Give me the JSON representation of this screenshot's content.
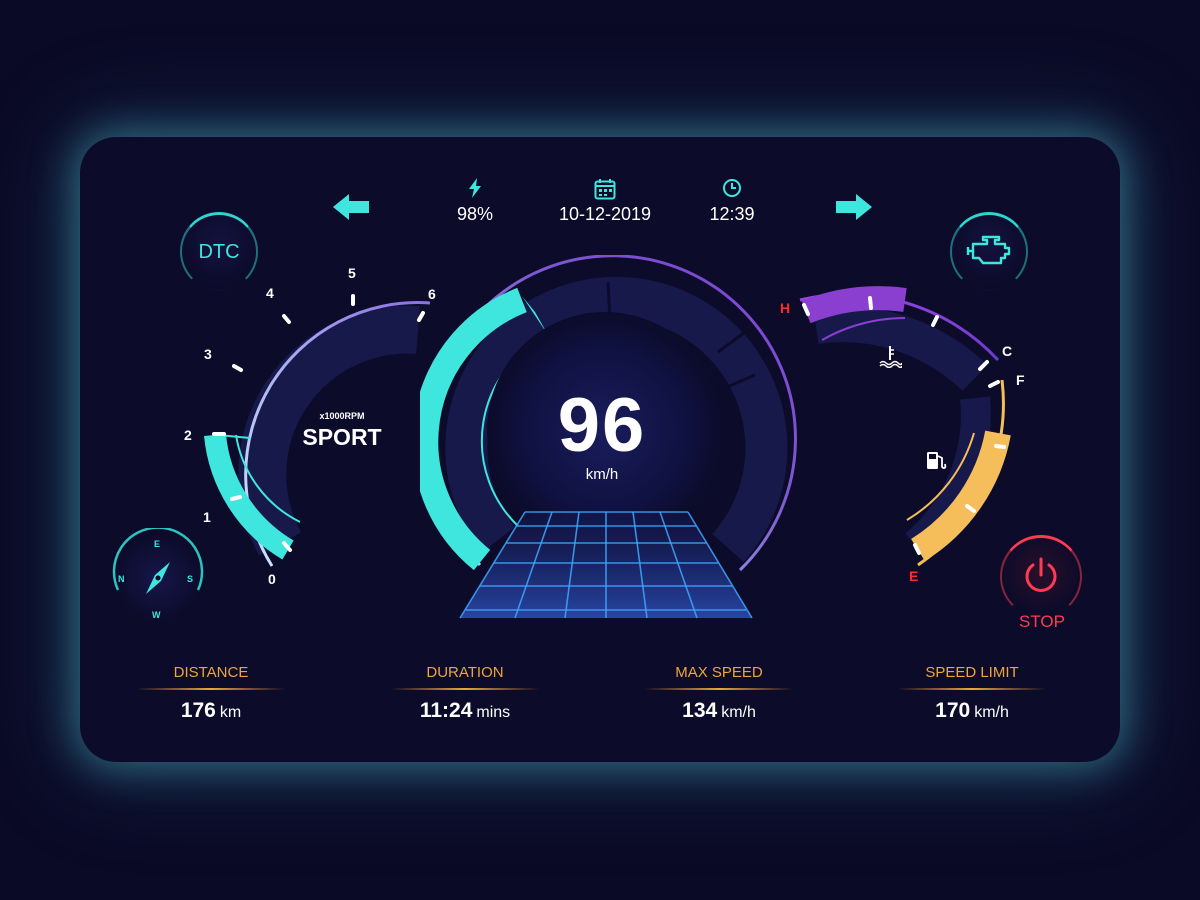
{
  "status": {
    "battery": "98%",
    "date": "10-12-2019",
    "time": "12:39"
  },
  "buttons": {
    "dtc_label": "DTC",
    "stop_label": "STOP"
  },
  "rpm_gauge": {
    "ticks": [
      "0",
      "1",
      "2",
      "3",
      "4",
      "5",
      "6"
    ],
    "unit_label": "x1000RPM",
    "mode": "SPORT",
    "value": 2
  },
  "compass": {
    "north": "N",
    "east": "E",
    "south": "S",
    "west": "W"
  },
  "speedometer": {
    "value": "96",
    "unit": "km/h"
  },
  "temp_gauge": {
    "hot_label": "H",
    "cold_label": "C"
  },
  "fuel_gauge": {
    "full_label": "F",
    "empty_label": "E"
  },
  "stats": [
    {
      "label": "DISTANCE",
      "value": "176",
      "unit": "km"
    },
    {
      "label": "DURATION",
      "value": "11:24",
      "unit": "mins"
    },
    {
      "label": "MAX SPEED",
      "value": "134",
      "unit": "km/h"
    },
    {
      "label": "SPEED LIMIT",
      "value": "170",
      "unit": "km/h"
    }
  ],
  "colors": {
    "accent": "#2fd6d0",
    "temperature": "#8a3fd1",
    "fuel": "#f5be5a",
    "stop": "#ff3b52",
    "stat_label": "#f0a43a"
  }
}
